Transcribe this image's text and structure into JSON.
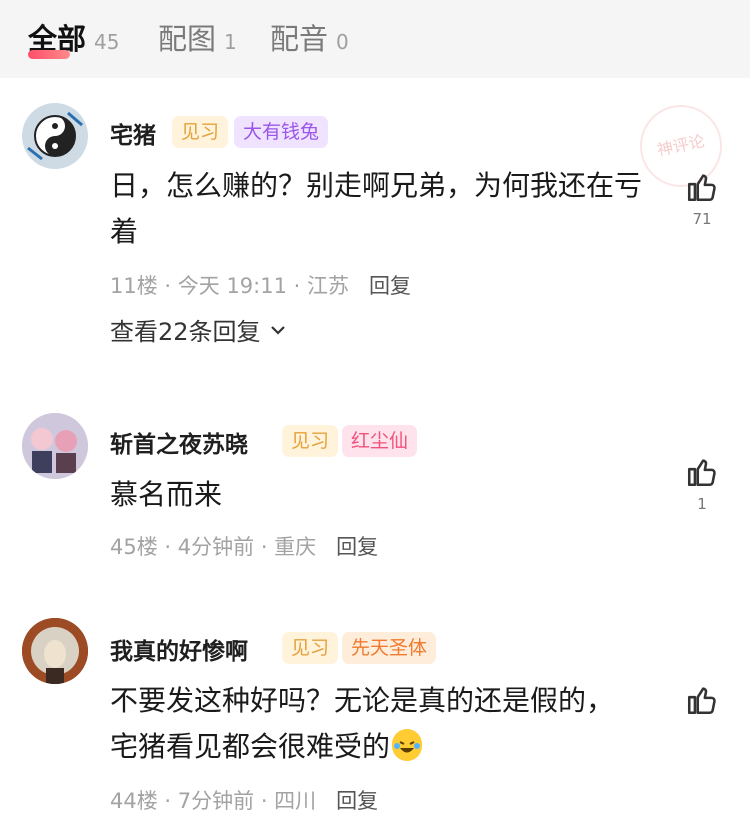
{
  "tabs": [
    {
      "label": "全部",
      "count": "45",
      "active": true
    },
    {
      "label": "配图",
      "count": "1"
    },
    {
      "label": "配音",
      "count": "0"
    }
  ],
  "watermark": "神评论",
  "comments": [
    {
      "username": "宅猪",
      "level_badge": "见习",
      "title_badge": "大有钱兔",
      "text": "日，怎么赚的？别走啊兄弟，为何我还在亏着",
      "floor": "11楼",
      "time": "今天 19:11",
      "location": "江苏",
      "reply": "回复",
      "likes": "71",
      "view_replies": "查看22条回复"
    },
    {
      "username": "斩首之夜苏晓",
      "level_badge": "见习",
      "title_badge": "红尘仙",
      "text": "慕名而来",
      "floor": "45楼",
      "time": "4分钟前",
      "location": "重庆",
      "reply": "回复",
      "likes": "1"
    },
    {
      "username": "我真的好惨啊",
      "level_badge": "见习",
      "title_badge": "先天圣体",
      "text": "不要发这种好吗？无论是真的还是假的，宅猪看见都会很难受的",
      "emoji": "laughing-crying-emoji",
      "floor": "44楼",
      "time": "7分钟前",
      "location": "四川",
      "reply": "回复",
      "likes": ""
    }
  ],
  "separator": " · ",
  "icons": {
    "like": "thumbs-up-icon",
    "expand": "chevron-down-icon"
  }
}
